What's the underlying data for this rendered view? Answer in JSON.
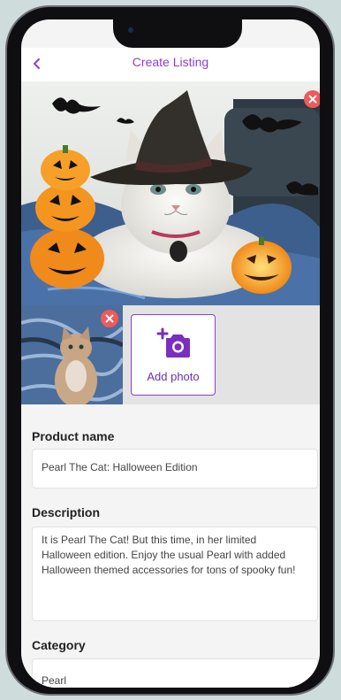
{
  "header": {
    "title": "Create Listing",
    "back_icon": "chevron-left-icon"
  },
  "photos": {
    "main_remove_icon": "close-icon",
    "thumb_remove_icon": "close-icon",
    "add_photo_label": "Add photo",
    "add_photo_icon": "add-camera-icon"
  },
  "form": {
    "product_name_label": "Product name",
    "product_name_value": "Pearl The Cat: Halloween Edition",
    "description_label": "Description",
    "description_value": "It is Pearl The Cat! But this time, in her limited Halloween edition. Enjoy the usual Pearl with added Halloween themed accessories for tons of spooky fun!",
    "category_label": "Category",
    "category_value": "Pearl"
  },
  "colors": {
    "accent": "#8a3fd0",
    "remove": "#ee5a5a"
  }
}
